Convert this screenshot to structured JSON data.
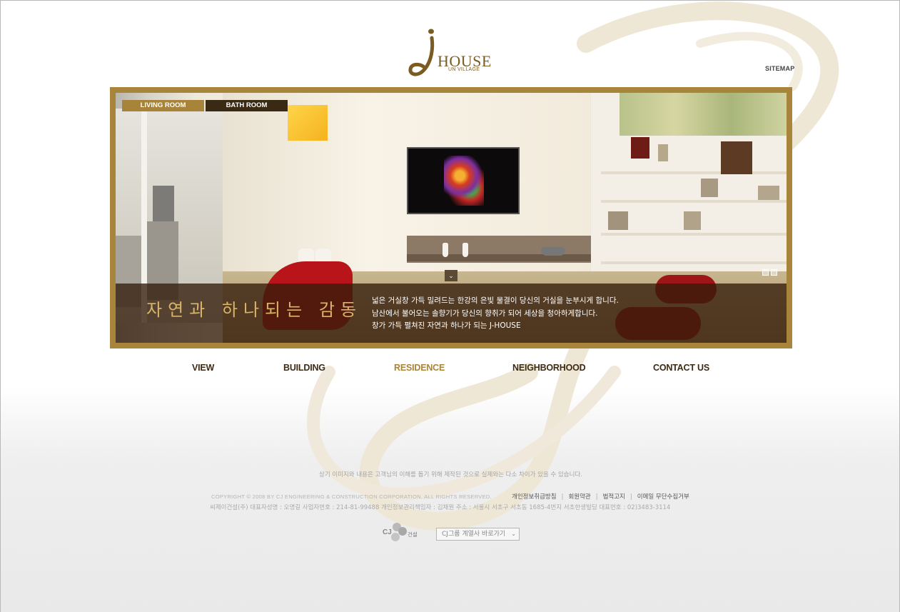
{
  "header": {
    "logo_letter": "J",
    "logo_name": "HOUSE",
    "logo_sub": "UN VILLAGE",
    "sitemap_label": "SITEMAP"
  },
  "hero": {
    "tabs": [
      {
        "label": "LIVING ROOM",
        "active": true
      },
      {
        "label": "BATH ROOM",
        "active": false
      }
    ],
    "caption_title": "자연과 하나되는 감동",
    "caption_lines": [
      "넓은 거실창 가득 밀려드는 한강의 은빛 물결이 당신의 거실을 눈부시게 합니다.",
      "남산에서 불어오는 솔향기가 당신의 향취가 되어 세상을 청아하게합니다.",
      "창가 가득 펼쳐진 자연과 하나가 되는 J-HOUSE"
    ],
    "arrow_icon": "chevron-down-icon",
    "pager_count": 2
  },
  "nav": {
    "items": [
      {
        "label": "VIEW",
        "active": false
      },
      {
        "label": "BUILDING",
        "active": false
      },
      {
        "label": "RESIDENCE",
        "active": true
      },
      {
        "label": "NEIGHBORHOOD",
        "active": false
      },
      {
        "label": "CONTACT US",
        "active": false
      }
    ]
  },
  "footer": {
    "disclaimer": "상기 이미지와 내용은 고객님의 이해를 돕기 위해 제작된 것으로 실제와는 다소 차이가 있을 수 있습니다.",
    "copyright": "COPYRIGHT © 2008 BY CJ ENGINEERING & CONSTRUCTION CORPORATION. ALL RIGHTS RESERVED.",
    "links": [
      "개인정보취급방침",
      "회원약관",
      "법적고지",
      "이메일 무단수집거부"
    ],
    "company_info": "씨제이건설(주)   대표자성명 : 오명길   사업자번호 : 214-81-99488   개인정보관리책임자 : 김채원   주소 : 서울시 서초구 서초동 1685-4번지 서초한생빌딩   대표번호 : 02)3483-3114",
    "cj_text": "CJ",
    "cj_label": "건설",
    "group_select": "CJ그룹 계열사 바로가기"
  },
  "colors": {
    "gold": "#a8843a",
    "dark_brown": "#3a2a14",
    "nav_text": "#3d2a14"
  }
}
